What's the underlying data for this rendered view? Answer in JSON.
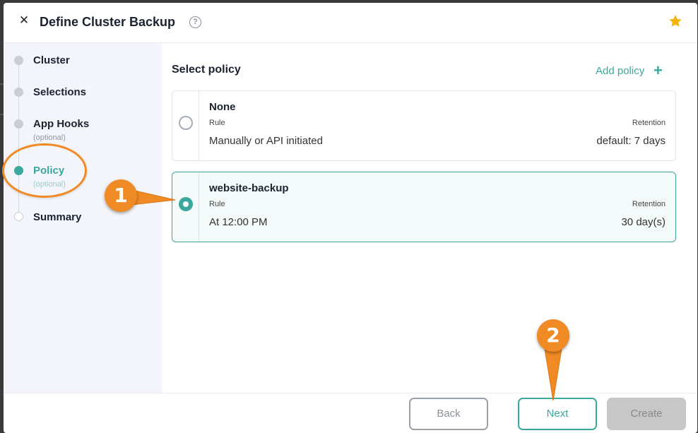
{
  "header": {
    "close_icon": "close-icon",
    "title": "Define Cluster Backup",
    "help_icon": "?",
    "star_color": "#f5b301"
  },
  "sidebar": {
    "steps": [
      {
        "label": "Cluster",
        "sub": "",
        "state": "done"
      },
      {
        "label": "Selections",
        "sub": "",
        "state": "done"
      },
      {
        "label": "App Hooks",
        "sub": "(optional)",
        "state": "done"
      },
      {
        "label": "Policy",
        "sub": "(optional)",
        "state": "active"
      },
      {
        "label": "Summary",
        "sub": "",
        "state": "pending"
      }
    ]
  },
  "main": {
    "section_title": "Select policy",
    "add_policy_label": "Add policy",
    "add_policy_icon": "+",
    "policies": [
      {
        "name": "None",
        "rule_header": "Rule",
        "retention_header": "Retention",
        "rule": "Manually or API initiated",
        "retention": "default: 7 days",
        "selected": false
      },
      {
        "name": "website-backup",
        "rule_header": "Rule",
        "retention_header": "Retention",
        "rule": "At 12:00 PM",
        "retention": "30 day(s)",
        "selected": true
      }
    ]
  },
  "footer": {
    "back_label": "Back",
    "next_label": "Next",
    "create_label": "Create"
  },
  "annotations": {
    "badge_1": "1",
    "badge_2": "2",
    "accent_color": "#f08a24"
  },
  "colors": {
    "accent": "#3aa89c",
    "sidebar_bg": "#f3f5fa"
  }
}
